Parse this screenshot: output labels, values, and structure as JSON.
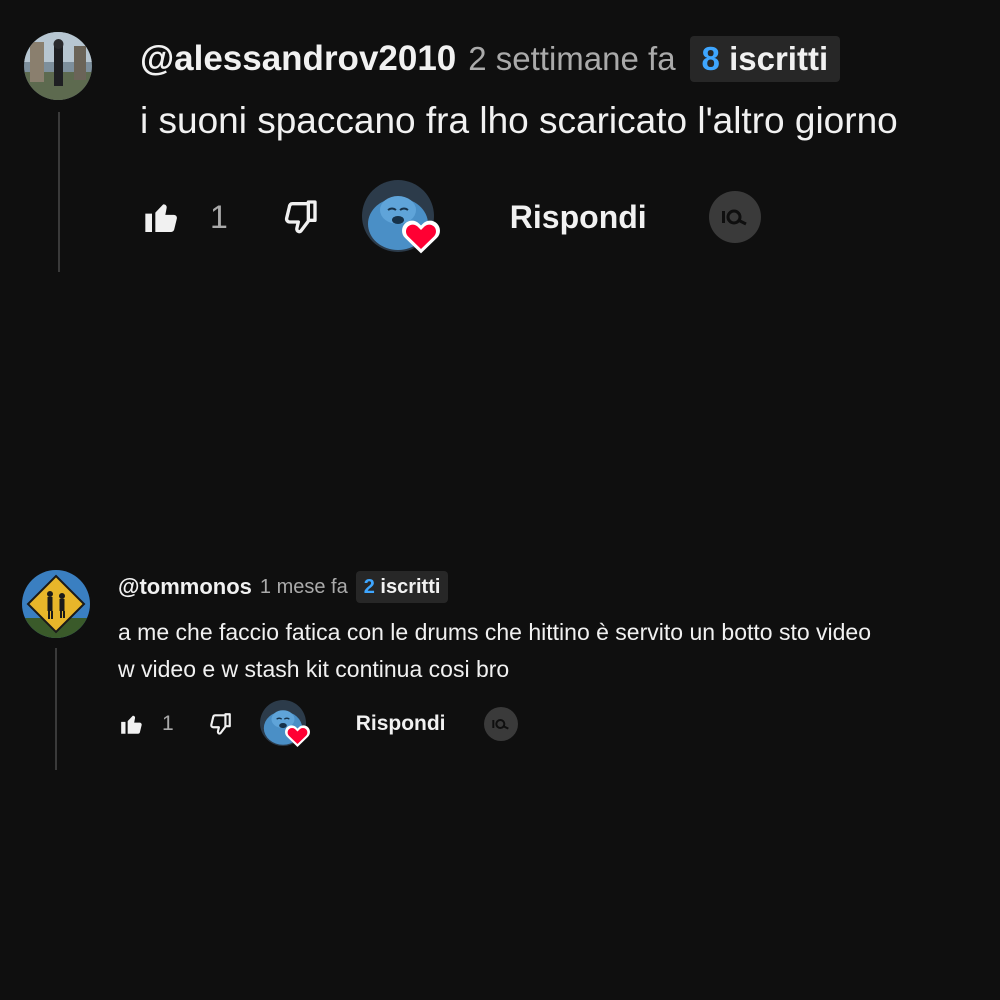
{
  "comments": [
    {
      "author": "@alessandrov2010",
      "time": "2 settimane fa",
      "badge_count": "8",
      "badge_label": "iscritti",
      "text_lines": [
        "i suoni spaccano fra lho scaricato l'altro giorno"
      ],
      "like_count": "1",
      "reply_label": "Rispondi"
    },
    {
      "author": "@tommonos",
      "time": "1 mese fa",
      "badge_count": "2",
      "badge_label": "iscritti",
      "text_lines": [
        "a me che faccio fatica con le drums che hittino è servito un botto sto video",
        "w video e w stash kit continua cosi bro"
      ],
      "like_count": "1",
      "reply_label": "Rispondi"
    }
  ],
  "colors": {
    "background": "#0f0f0f",
    "text": "#f1f1f1",
    "muted": "#aaaaaa",
    "badge_bg": "#272727",
    "badge_number": "#3ea6ff",
    "heart": "#ff0033"
  },
  "icons": {
    "like": "thumbs-up-icon",
    "dislike": "thumbs-down-icon",
    "heart": "heart-icon",
    "tool": "insights-icon"
  }
}
